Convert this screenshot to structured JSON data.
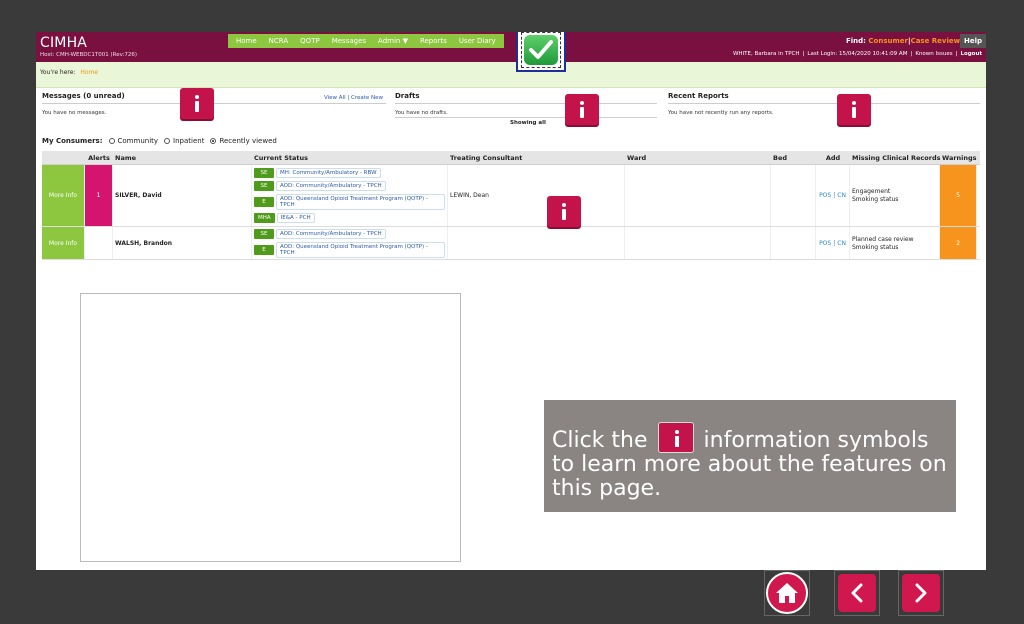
{
  "header": {
    "brand": "CIMHA",
    "host": "Host: CMH-WEBDC1T001 (Rev:726)",
    "nav": [
      "Home",
      "NCRA",
      "QOTP",
      "Messages",
      "Admin ▼",
      "Reports",
      "User Diary"
    ],
    "find_label": "Find:",
    "find_consumer": "Consumer",
    "find_sep": "|",
    "find_case_review": "Case Review",
    "help": "Help",
    "user": "WHITE, Barbara in TPCH",
    "last_login": "Last Login: 15/04/2020 10:41:09 AM",
    "known_issues": "Known Issues",
    "logout": "Logout"
  },
  "breadcrumb": {
    "label": "You're here:",
    "crumb": "Home"
  },
  "messages": {
    "title": "Messages (0 unread)",
    "view_all": "View All",
    "sep": "|",
    "create_new": "Create New",
    "empty": "You have no messages."
  },
  "drafts": {
    "title": "Drafts",
    "empty": "You have no drafts.",
    "showing": "Showing all"
  },
  "reports": {
    "title": "Recent Reports",
    "empty": "You have not recently run any reports."
  },
  "consumers": {
    "label": "My Consumers:",
    "options": [
      "Community",
      "Inpatient",
      "Recently viewed"
    ]
  },
  "table": {
    "headers": [
      "",
      "Alerts",
      "Name",
      "Current Status",
      "Treating Consultant",
      "Ward",
      "Bed",
      "Add",
      "Missing Clinical Records",
      "Warnings"
    ],
    "rows": [
      {
        "more": "More Info",
        "alerts": "1",
        "name": "SILVER, David",
        "statuses": [
          {
            "tag": "SE",
            "text": "MH: Community/Ambulatory - RBW"
          },
          {
            "tag": "SE",
            "text": "AOD: Community/Ambulatory - TPCH"
          },
          {
            "tag": "E",
            "text": "AOD: Queensland Opioid Treatment Program (QOTP) - TPCH"
          },
          {
            "tag": "MHA",
            "text": "IE&A - PCH"
          }
        ],
        "consultant": "LEWIN, Dean",
        "ward": "",
        "bed": "",
        "add_pos": "POS",
        "add_sep": "|",
        "add_cn": "CN",
        "missing": [
          "Engagement",
          "Smoking status"
        ],
        "warnings": "5"
      },
      {
        "more": "More Info",
        "alerts": "",
        "name": "WALSH, Brandon",
        "statuses": [
          {
            "tag": "SE",
            "text": "AOD: Community/Ambulatory - TPCH"
          },
          {
            "tag": "E",
            "text": "AOD: Queensland Opioid Treatment Program (QOTP) - TPCH"
          }
        ],
        "consultant": "",
        "ward": "",
        "bed": "",
        "add_pos": "POS",
        "add_sep": "|",
        "add_cn": "CN",
        "missing": [
          "Planned case review",
          "Smoking status"
        ],
        "warnings": "2"
      }
    ]
  },
  "callout": {
    "part1": "Click the",
    "part2": "information symbols to learn more about the features on this page."
  },
  "icons": {
    "info": "info-icon",
    "check": "checkmark-icon",
    "home": "home-icon",
    "prev": "chevron-left-icon",
    "next": "chevron-right-icon"
  },
  "colors": {
    "header": "#7a1040",
    "nav": "#8dc63f",
    "info": "#c4124a",
    "alert": "#d4146f",
    "warning": "#f7941d",
    "tag": "#4f9b1b"
  }
}
